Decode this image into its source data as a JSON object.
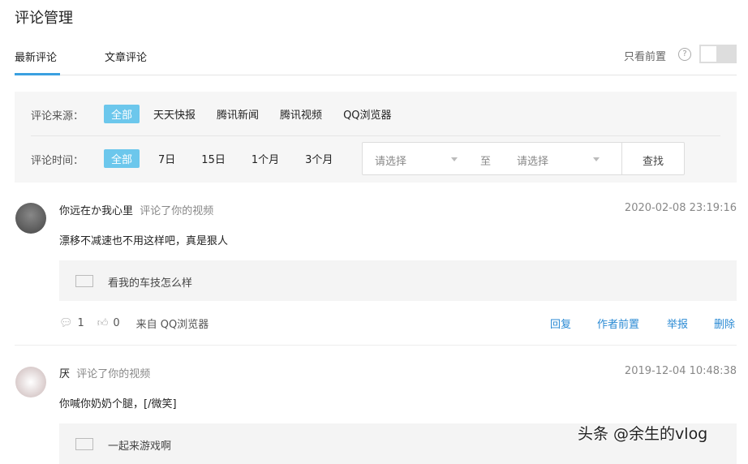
{
  "title": "评论管理",
  "tabs": [
    {
      "label": "最新评论"
    },
    {
      "label": "文章评论"
    }
  ],
  "pinned_only_label": "只看前置",
  "filters": {
    "source_label": "评论来源：",
    "sources": [
      "全部",
      "天天快报",
      "腾讯新闻",
      "腾讯视频",
      "QQ浏览器"
    ],
    "time_label": "评论时间：",
    "times": [
      "全部",
      "7日",
      "15日",
      "1个月",
      "3个月"
    ],
    "start_placeholder": "请选择",
    "to": "至",
    "end_placeholder": "请选择",
    "search": "查找"
  },
  "comments": [
    {
      "user": "你远在か我心里",
      "action": "评论了你的视频",
      "time": "2020-02-08 23:19:16",
      "text": "漂移不减速也不用这样吧，真是狠人",
      "video": "看我的车技怎么样",
      "replies": "1",
      "likes": "0",
      "source": "来自 QQ浏览器"
    },
    {
      "user": "厌",
      "action": "评论了你的视频",
      "time": "2019-12-04 10:48:38",
      "text": "你喊你奶奶个腿，[/微笑]",
      "video": "一起来游戏啊"
    }
  ],
  "actions": {
    "reply": "回复",
    "pin": "作者前置",
    "report": "举报",
    "delete": "删除"
  },
  "watermark": "头条 @余生的vlog"
}
